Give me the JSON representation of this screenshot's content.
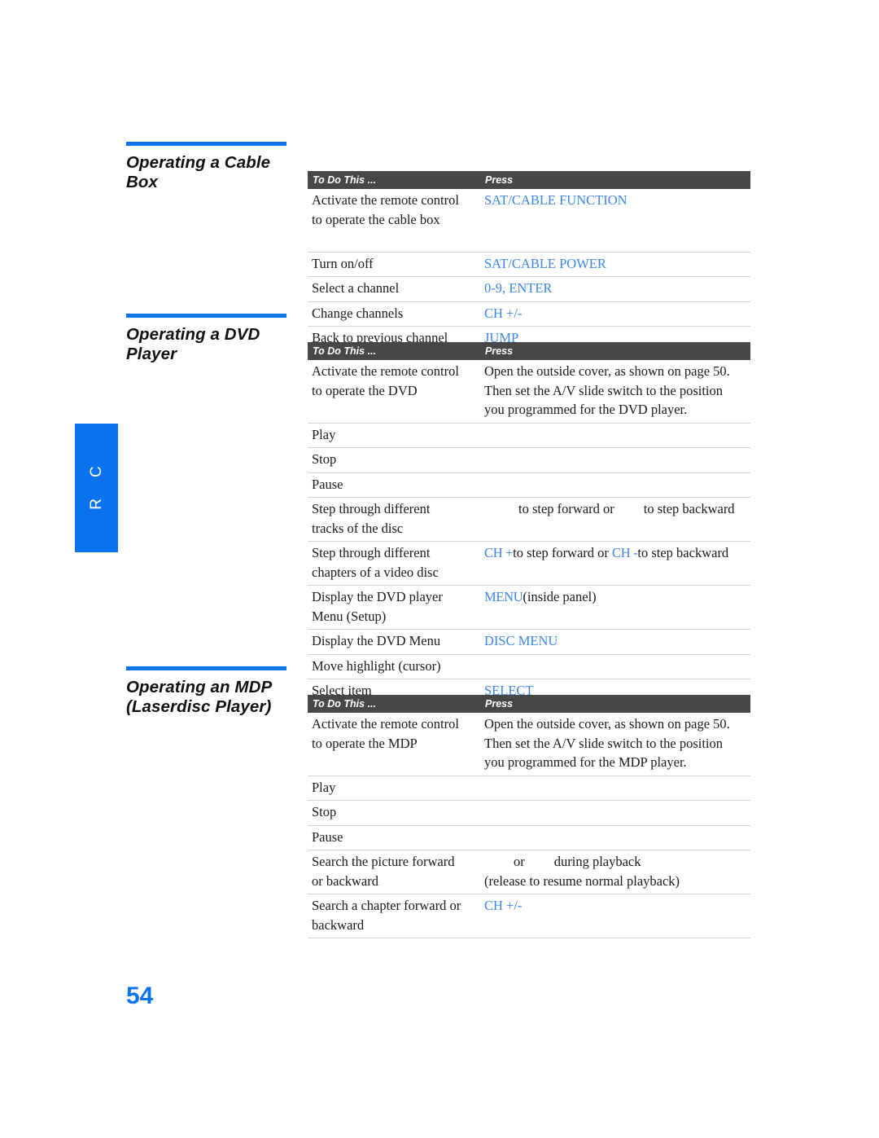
{
  "page": {
    "number": "54",
    "side_tab_label": "RC"
  },
  "sections": [
    {
      "heading": "Operating a Cable Box",
      "heading_lines": [
        "Operating a Cable",
        "Box"
      ],
      "table": {
        "columns": [
          "To Do This ...",
          "Press"
        ],
        "rows": [
          {
            "todo": "Activate the remote control to operate the cable box",
            "todo_lines": [
              "Activate the remote control",
              "to operate the cable box"
            ],
            "press_lines": [
              [
                {
                  "text": "SAT/CABLE FUNCTION",
                  "color": "blue"
                }
              ],
              [],
              []
            ]
          },
          {
            "todo": "Turn on/off",
            "todo_lines": [
              "Turn on/off"
            ],
            "press_lines": [
              [
                {
                  "text": "SAT/CABLE POWER",
                  "color": "blue"
                }
              ]
            ]
          },
          {
            "todo": "Select a channel",
            "todo_lines": [
              "Select a channel"
            ],
            "press_lines": [
              [
                {
                  "text": "0-9, ENTER",
                  "color": "blue"
                }
              ]
            ]
          },
          {
            "todo": "Change channels",
            "todo_lines": [
              "Change channels"
            ],
            "press_lines": [
              [
                {
                  "text": "CH +/-",
                  "color": "blue"
                }
              ]
            ]
          },
          {
            "todo": "Back to previous channel",
            "todo_lines": [
              "Back to previous channel"
            ],
            "press_lines": [
              [
                {
                  "text": "JUMP",
                  "color": "blue"
                }
              ]
            ]
          }
        ]
      }
    },
    {
      "heading": "Operating a DVD Player",
      "heading_lines": [
        "Operating a DVD",
        "Player"
      ],
      "table": {
        "columns": [
          "To Do This ...",
          "Press"
        ],
        "rows": [
          {
            "todo": "Activate the remote control to operate the DVD",
            "todo_lines": [
              "Activate the remote control",
              "to operate the DVD"
            ],
            "press_lines": [
              [
                {
                  "text": "Open the outside cover, as shown on page 50.",
                  "color": "black"
                }
              ],
              [
                {
                  "text": "Then set the A/V slide switch to the position",
                  "color": "black"
                }
              ],
              [
                {
                  "text": "you programmed for the DVD player.",
                  "color": "black"
                }
              ]
            ]
          },
          {
            "todo": "Play",
            "todo_lines": [
              "Play"
            ],
            "press_lines": [
              []
            ]
          },
          {
            "todo": "Stop",
            "todo_lines": [
              "Stop"
            ],
            "press_lines": [
              []
            ]
          },
          {
            "todo": "Pause",
            "todo_lines": [
              "Pause"
            ],
            "press_lines": [
              []
            ]
          },
          {
            "todo": "Step through different tracks of the disc",
            "todo_lines": [
              "Step through different",
              "tracks of the disc"
            ],
            "press_lines": [
              [
                {
                  "text": "",
                  "color": "black",
                  "indent": "lg"
                },
                {
                  "text": "to step forward or",
                  "color": "black"
                },
                {
                  "text": "",
                  "color": "black",
                  "indent": "md"
                },
                {
                  "text": "to step backward",
                  "color": "black"
                }
              ],
              []
            ]
          },
          {
            "todo": "Step through different chapters of a video disc",
            "todo_lines": [
              "Step through different",
              "chapters of a video disc"
            ],
            "press_lines": [
              [
                {
                  "text": "CH +",
                  "color": "blue",
                  "tight": true
                },
                {
                  "text": "to step forward or ",
                  "color": "black"
                },
                {
                  "text": "CH -",
                  "color": "blue",
                  "tight": true
                },
                {
                  "text": "to step backward",
                  "color": "black"
                }
              ],
              []
            ]
          },
          {
            "todo": "Display the DVD player Menu (Setup)",
            "todo_lines": [
              "Display the DVD player",
              "Menu (Setup)"
            ],
            "press_lines": [
              [
                {
                  "text": "MENU",
                  "color": "blue",
                  "tight": true
                },
                {
                  "text": "(inside panel)",
                  "color": "black"
                }
              ],
              []
            ]
          },
          {
            "todo": "Display the DVD Menu",
            "todo_lines": [
              "Display the DVD Menu"
            ],
            "press_lines": [
              [
                {
                  "text": "DISC MENU",
                  "color": "blue"
                }
              ]
            ]
          },
          {
            "todo": "Move highlight (cursor)",
            "todo_lines": [
              "Move highlight (cursor)"
            ],
            "press_lines": [
              []
            ]
          },
          {
            "todo": "Select item",
            "todo_lines": [
              "Select item"
            ],
            "press_lines": [
              [
                {
                  "text": "SELECT",
                  "color": "blue"
                }
              ]
            ]
          }
        ]
      }
    },
    {
      "heading": "Operating an MDP (Laserdisc Player)",
      "heading_lines": [
        "Operating an MDP",
        "(Laserdisc Player)"
      ],
      "table": {
        "columns": [
          "To Do This ...",
          "Press"
        ],
        "rows": [
          {
            "todo": "Activate the remote control to operate the MDP",
            "todo_lines": [
              "Activate the remote control",
              "to operate the MDP"
            ],
            "press_lines": [
              [
                {
                  "text": "Open the outside cover, as shown on page 50.",
                  "color": "black"
                }
              ],
              [
                {
                  "text": "Then set the A/V slide switch to the position",
                  "color": "black"
                }
              ],
              [
                {
                  "text": "you programmed for the MDP player.",
                  "color": "black"
                }
              ]
            ]
          },
          {
            "todo": "Play",
            "todo_lines": [
              "Play"
            ],
            "press_lines": [
              []
            ]
          },
          {
            "todo": "Stop",
            "todo_lines": [
              "Stop"
            ],
            "press_lines": [
              []
            ]
          },
          {
            "todo": "Pause",
            "todo_lines": [
              "Pause"
            ],
            "press_lines": [
              []
            ]
          },
          {
            "todo": "Search the picture forward or backward",
            "todo_lines": [
              "Search the picture forward",
              "or backward"
            ],
            "press_lines": [
              [
                {
                  "text": "",
                  "color": "black",
                  "indent": "md"
                },
                {
                  "text": "or",
                  "color": "black"
                },
                {
                  "text": "",
                  "color": "black",
                  "indent": "md"
                },
                {
                  "text": "during playback",
                  "color": "black"
                }
              ],
              [
                {
                  "text": "(release to resume normal playback)",
                  "color": "black"
                }
              ]
            ]
          },
          {
            "todo": "Search a chapter forward or backward",
            "todo_lines": [
              "Search a chapter forward or",
              "backward"
            ],
            "press_lines": [
              [
                {
                  "text": "CH +/-",
                  "color": "blue"
                }
              ],
              []
            ]
          }
        ]
      }
    }
  ]
}
